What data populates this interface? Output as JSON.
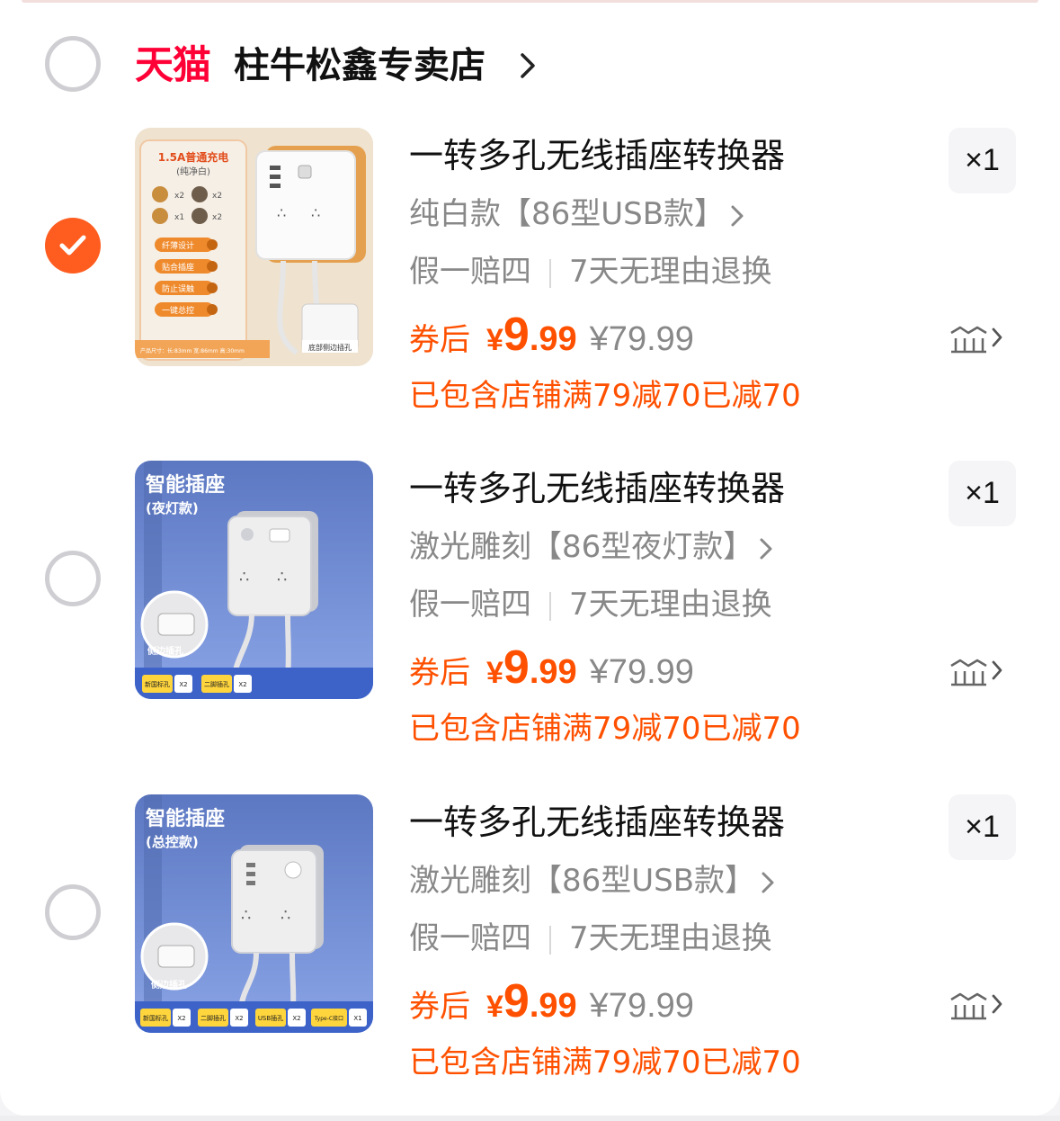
{
  "store": {
    "platform_logo": "天猫",
    "name": "柱牛松鑫专卖店",
    "selected": false
  },
  "colors": {
    "accent": "#ff5000",
    "tmall_red": "#ff0036",
    "check_orange": "#ff5d1f",
    "muted_text": "#888888"
  },
  "items": [
    {
      "selected": true,
      "title": "一转多孔无线插座转换器",
      "sku": "纯白款【86型USB款】",
      "guarantee_1": "假一赔四",
      "guarantee_2": "7天无理由退换",
      "coupon_label": "券后",
      "currency": "¥",
      "price_int": "9",
      "price_dec": ".99",
      "original_price": "¥79.99",
      "discount_note": "已包含店铺满79减70已减70",
      "quantity": "×1",
      "image": {
        "badge": "1.5A普通充电",
        "badge_sub": "(纯净白)",
        "counts": [
          "x2",
          "x2",
          "x1",
          "x2"
        ],
        "features": [
          "纤薄设计",
          "贴合插座",
          "防止误触",
          "一键总控"
        ],
        "footer": "产品尺寸：长:83mm 宽:86mm 高:30mm",
        "callout": "底部侧边插孔"
      }
    },
    {
      "selected": false,
      "title": "一转多孔无线插座转换器",
      "sku": "激光雕刻【86型夜灯款】",
      "guarantee_1": "假一赔四",
      "guarantee_2": "7天无理由退换",
      "coupon_label": "券后",
      "currency": "¥",
      "price_int": "9",
      "price_dec": ".99",
      "original_price": "¥79.99",
      "discount_note": "已包含店铺满79减70已减70",
      "quantity": "×1",
      "image": {
        "heading": "智能插座",
        "subheading": "(夜灯款)",
        "callout": "侧边插孔",
        "tags": [
          {
            "label": "新国标孔",
            "count": "X2"
          },
          {
            "label": "二脚插孔",
            "count": "X2"
          }
        ]
      }
    },
    {
      "selected": false,
      "title": "一转多孔无线插座转换器",
      "sku": "激光雕刻【86型USB款】",
      "guarantee_1": "假一赔四",
      "guarantee_2": "7天无理由退换",
      "coupon_label": "券后",
      "currency": "¥",
      "price_int": "9",
      "price_dec": ".99",
      "original_price": "¥79.99",
      "discount_note": "已包含店铺满79减70已减70",
      "quantity": "×1",
      "image": {
        "heading": "智能插座",
        "subheading": "(总控款)",
        "callout": "侧边插孔",
        "tags": [
          {
            "label": "新国标孔",
            "count": "X2"
          },
          {
            "label": "二脚插孔",
            "count": "X2"
          },
          {
            "label": "USB插孔",
            "count": "X2"
          },
          {
            "label": "Type-C接口",
            "count": "X1"
          }
        ]
      }
    }
  ]
}
